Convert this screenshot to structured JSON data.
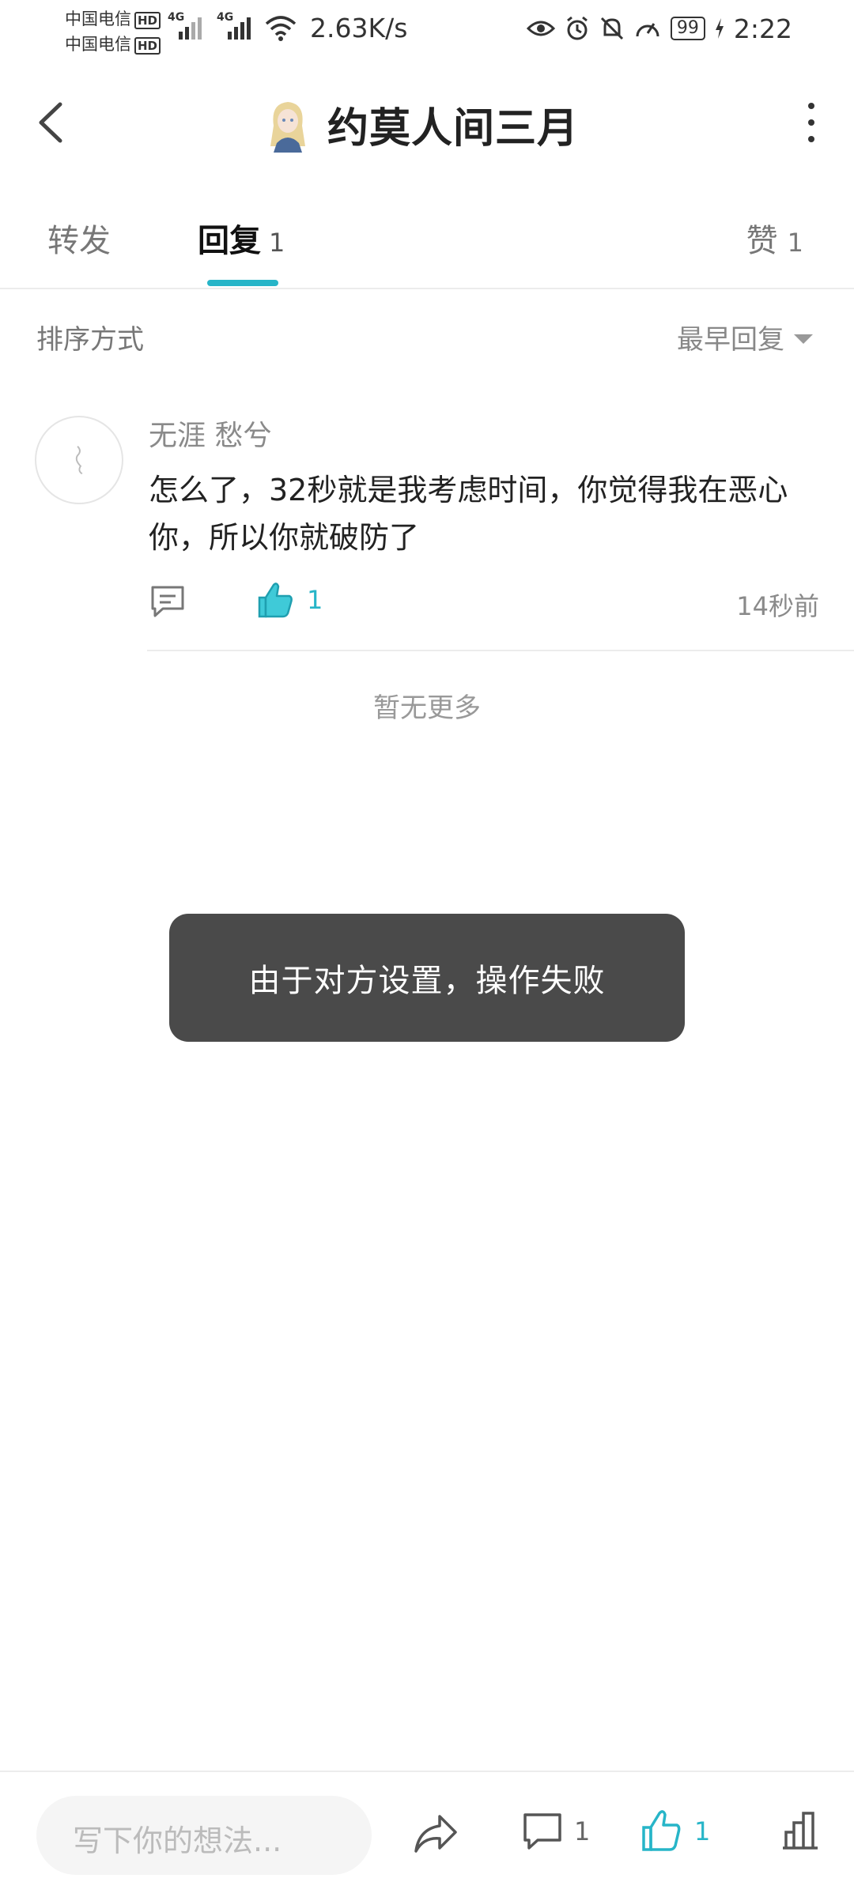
{
  "status_bar": {
    "carrier1": "中国电信",
    "carrier2": "中国电信",
    "hd": "HD",
    "net1": "4G",
    "net2": "4G",
    "speed": "2.63K/s",
    "battery": "99",
    "time": "2:22"
  },
  "header": {
    "title": "约莫人间三月"
  },
  "tabs": {
    "forward_label": "转发",
    "reply_label": "回复",
    "reply_count": "1",
    "like_label": "赞",
    "like_count": "1"
  },
  "sort": {
    "label": "排序方式",
    "value": "最早回复"
  },
  "comment": {
    "author": "无涯 愁兮",
    "text": "怎么了，32秒就是我考虑时间，你觉得我在恶心你，所以你就破防了",
    "like_count": "1",
    "time": "14秒前"
  },
  "no_more": "暂无更多",
  "toast": "由于对方设置，操作失败",
  "bottom_bar": {
    "input_placeholder": "写下你的想法...",
    "comment_count": "1",
    "like_count": "1"
  },
  "colors": {
    "accent": "#27b5c8",
    "toast_bg": "#4a4a4a"
  }
}
